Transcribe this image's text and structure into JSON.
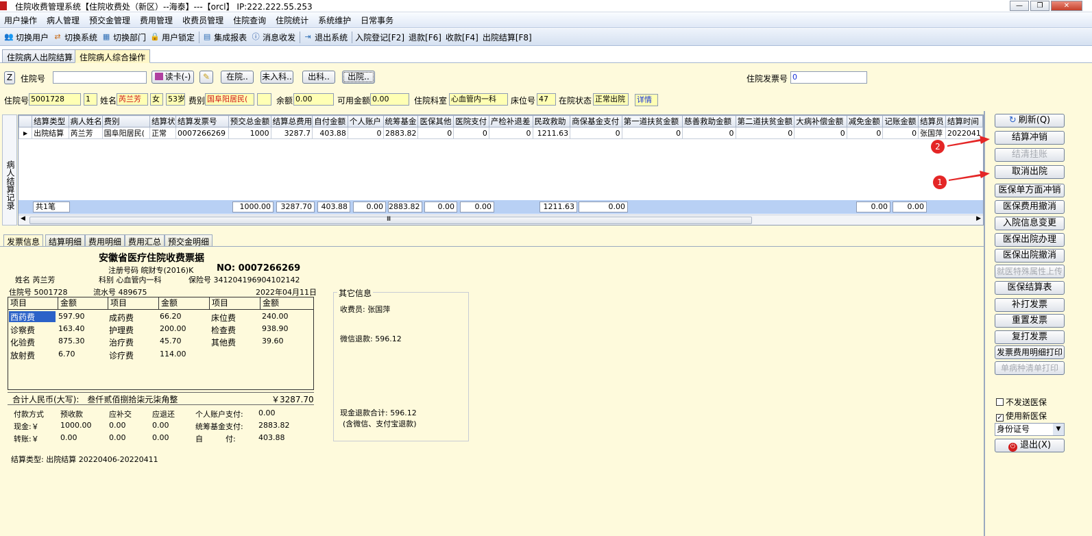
{
  "window": {
    "title": "住院收费管理系统【住院收费处（新区）--海泰】---【orcl】 IP:222.222.55.253",
    "min": "—",
    "max": "❐",
    "close": "✕"
  },
  "menu": [
    "用户操作",
    "病人管理",
    "预交金管理",
    "费用管理",
    "收费员管理",
    "住院查询",
    "住院统计",
    "系统维护",
    "日常事务"
  ],
  "toolbar": [
    {
      "label": "切换用户",
      "icon": "users-icon"
    },
    {
      "label": "切换系统",
      "icon": "switch-icon"
    },
    {
      "label": "切换部门",
      "icon": "department-icon"
    },
    {
      "label": "用户锁定",
      "icon": "lock-user-icon"
    },
    {
      "label": "集成报表",
      "icon": "report-icon"
    },
    {
      "label": "消息收发",
      "icon": "info-icon"
    },
    {
      "label": "退出系统",
      "icon": "exit-icon"
    }
  ],
  "shortcuts": [
    "入院登记[F2]",
    "退款[F6]",
    "收款[F4]",
    "出院结算[F8]"
  ],
  "tabs": [
    "住院病人出院结算",
    "住院病人综合操作"
  ],
  "search": {
    "z_label": "Z",
    "label": "住院号",
    "value": "",
    "card_btn": "读卡(-)",
    "btns": [
      "在院..",
      "未入科..",
      "出科..",
      "出院.."
    ],
    "invoice_label": "住院发票号",
    "invoice_value": "0"
  },
  "patient": {
    "id_label": "住院号",
    "id": "5001728",
    "id2": "1",
    "name_label": "姓名",
    "name": "芮兰芳",
    "sex": "女",
    "age": "53岁",
    "type_label": "费别",
    "type": "国阜阳居民(",
    "balance_label": "余额",
    "balance": "0.00",
    "avail_label": "可用金额",
    "avail": "0.00",
    "dept_label": "住院科室",
    "dept": "心血管内一科",
    "bed_label": "床位号",
    "bed": "47",
    "status_label": "在院状态",
    "status": "正常出院",
    "detail": "详情"
  },
  "records": {
    "side_label": "病人结算记录",
    "headers": [
      "结算类型",
      "病人姓名",
      "费别",
      "结算状",
      "结算发票号",
      "预交总金额",
      "结算总费用",
      "自付金额",
      "个人账户",
      "统筹基金",
      "医保其他",
      "医院支付",
      "产检补退差",
      "民政救助",
      "商保基金支付",
      "第一道扶贫金额",
      "慈善救助金额",
      "第二道扶贫金额",
      "大病补偿金额",
      "减免金额",
      "记账金额",
      "结算员",
      "结算时间"
    ],
    "rows": [
      [
        "出院结算",
        "芮兰芳",
        "国阜阳居民(",
        "正常",
        "0007266269",
        "1000",
        "3287.7",
        "403.88",
        "0",
        "2883.82",
        "0",
        "0",
        "0",
        "1211.63",
        "0",
        "0",
        "0",
        "0",
        "0",
        "0",
        "0",
        "张国萍",
        "2022041"
      ]
    ],
    "total_label": "共1笔",
    "totals": [
      "1000.00",
      "3287.70",
      "403.88",
      "0.00",
      "2883.82",
      "0.00",
      "0.00",
      "1211.63",
      "0.00",
      "0.00",
      "0.00"
    ],
    "scroll_mark": "Ⅲ"
  },
  "bottom_tabs": [
    "发票信息",
    "结算明细",
    "费用明细",
    "费用汇总",
    "预交金明细"
  ],
  "invoice": {
    "title": "安徽省医疗住院收费票据",
    "reg": "注册号码 皖财专(2016)K",
    "no": "NO: 0007266269",
    "name": "姓名 芮兰芳",
    "dept": "科别 心血管内一科",
    "ins": "保险号 341204196904102142",
    "hosp_id": "住院号 5001728",
    "serial": "流水号 489675",
    "date": "2022年04月11日",
    "table_headers": [
      "项目",
      "金额",
      "项目",
      "金额",
      "项目",
      "金额"
    ],
    "items": [
      [
        "西药费",
        "597.90",
        "成药费",
        "66.20",
        "床位费",
        "240.00"
      ],
      [
        "诊察费",
        "163.40",
        "护理费",
        "200.00",
        "检查费",
        "938.90"
      ],
      [
        "化验费",
        "875.30",
        "治疗费",
        "45.70",
        "其他费",
        "39.60"
      ],
      [
        "放射费",
        "6.70",
        "诊疗费",
        "114.00",
        "",
        ""
      ]
    ],
    "total_text": "合计人民币(大写):　叁仟贰佰捌拾柒元柒角整",
    "total_amount": "￥3287.70",
    "pay_rows": [
      [
        "付款方式",
        "预收款",
        "应补交",
        "应退还",
        "个人账户支付:",
        "0.00"
      ],
      [
        "现金:￥",
        "1000.00",
        "0.00",
        "0.00",
        "统筹基金支付:",
        "2883.82"
      ],
      [
        "转账:￥",
        "0.00",
        "0.00",
        "0.00",
        "自　　　付:",
        "403.88"
      ]
    ],
    "settle_type": "结算类型: 出院结算 20220406-20220411",
    "other_title": "其它信息",
    "cashier": "收费员: 张国萍",
    "wechat": "微信退款: 596.12",
    "cash_total": "现金退款合计: 596.12",
    "cash_note": "(含微信、支付宝退款)"
  },
  "right_buttons": [
    {
      "label": "刷新(Q)",
      "dis": false
    },
    {
      "label": "结算冲销",
      "dis": false
    },
    {
      "label": "结清挂账",
      "dis": true
    },
    {
      "label": "取消出院",
      "dis": false
    },
    {
      "label": "医保单方面冲销",
      "dis": false
    },
    {
      "label": "医保费用撤消",
      "dis": false
    },
    {
      "label": "入院信息变更",
      "dis": false
    },
    {
      "label": "医保出院办理",
      "dis": false
    },
    {
      "label": "医保出院撤消",
      "dis": false
    },
    {
      "label": "就医特殊属性上传",
      "dis": true
    },
    {
      "label": "医保结算表",
      "dis": false
    },
    {
      "label": "补打发票",
      "dis": false
    },
    {
      "label": "重置发票",
      "dis": false
    },
    {
      "label": "复打发票",
      "dis": false
    },
    {
      "label": "发票费用明细打印",
      "dis": false
    },
    {
      "label": "单病种清单打印",
      "dis": true
    }
  ],
  "checks": [
    {
      "label": "不发送医保",
      "checked": false
    },
    {
      "label": "使用新医保",
      "checked": true
    }
  ],
  "id_select": "身份证号",
  "exit_btn": "退出(X)",
  "annotations": {
    "badge1": "1",
    "badge2": "2",
    "arrow_color": "#e42626"
  }
}
